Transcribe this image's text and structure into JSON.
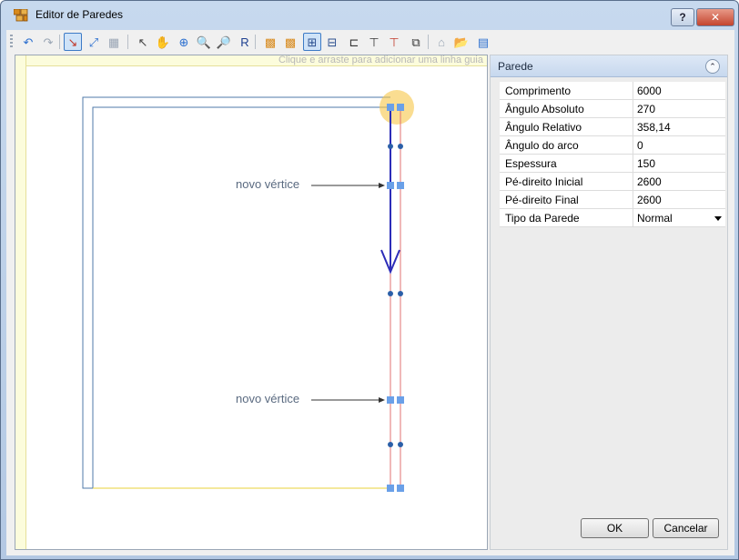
{
  "window": {
    "title": "Editor de Paredes",
    "help_label": "?",
    "close_label": "✕"
  },
  "toolbar": {
    "tools": [
      {
        "icon": "undo-icon",
        "glyph": "↶",
        "color": "#2b6fcf"
      },
      {
        "icon": "redo-icon",
        "glyph": "↷",
        "color": "#9aa6b5"
      },
      {
        "icon": "draw-wall-icon",
        "glyph": "↘",
        "color": "#c0392b"
      },
      {
        "icon": "split-wall-icon",
        "glyph": "⤢",
        "color": "#2b6fcf"
      },
      {
        "icon": "grid-icon",
        "glyph": "▦",
        "color": "#9aa6b5"
      },
      {
        "icon": "select-pointer-icon",
        "glyph": "↖",
        "color": "#444444"
      },
      {
        "icon": "pan-hand-icon",
        "glyph": "✋",
        "color": "#8a5a00"
      },
      {
        "icon": "zoom-extents-icon",
        "glyph": "⊕",
        "color": "#2b6fcf"
      },
      {
        "icon": "zoom-in-icon",
        "glyph": "🔍",
        "color": "#2b6fcf"
      },
      {
        "icon": "zoom-out-icon",
        "glyph": "🔎",
        "color": "#2b6fcf"
      },
      {
        "icon": "redraw-icon",
        "glyph": "R",
        "color": "#1d3f8f"
      },
      {
        "icon": "wall-block-icon",
        "glyph": "▩",
        "color": "#d88a1c"
      },
      {
        "icon": "wall-block-add-icon",
        "glyph": "▩",
        "color": "#d88a1c"
      },
      {
        "icon": "add-vertex-icon",
        "glyph": "⊞",
        "color": "#2b4f8f"
      },
      {
        "icon": "remove-vertex-icon",
        "glyph": "⊟",
        "color": "#2b4f8f"
      },
      {
        "icon": "align-icon",
        "glyph": "⊏",
        "color": "#333333"
      },
      {
        "icon": "measure-icon",
        "glyph": "⊤",
        "color": "#333333"
      },
      {
        "icon": "mark-icon",
        "glyph": "⊤",
        "color": "#c0392b"
      },
      {
        "icon": "copy-icon",
        "glyph": "⧉",
        "color": "#333333"
      },
      {
        "icon": "roof-icon",
        "glyph": "⌂",
        "color": "#9aa6b5"
      },
      {
        "icon": "import-icon",
        "glyph": "📂",
        "color": "#d88a1c"
      },
      {
        "icon": "export-icon",
        "glyph": "▤",
        "color": "#2b6fcf"
      }
    ]
  },
  "canvas": {
    "guide_hint": "Clique e arraste para adicionar uma linha guia",
    "annotations": [
      "novo vértice",
      "novo vértice"
    ]
  },
  "properties": {
    "header": "Parede",
    "rows": [
      {
        "name": "Comprimento",
        "value": "6000"
      },
      {
        "name": "Ângulo Absoluto",
        "value": "270"
      },
      {
        "name": "Ângulo Relativo",
        "value": "358,14"
      },
      {
        "name": "Ângulo do arco",
        "value": "0"
      },
      {
        "name": "Espessura",
        "value": "150"
      },
      {
        "name": "Pé-direito Inicial",
        "value": "2600"
      },
      {
        "name": "Pé-direito Final",
        "value": "2600"
      },
      {
        "name": "Tipo da Parede",
        "value": "Normal"
      }
    ]
  },
  "buttons": {
    "ok": "OK",
    "cancel": "Cancelar"
  },
  "colors": {
    "wall_outline": "#4f7aa8",
    "selected_wall": "#2c2cb8",
    "inner_wall_edge": "#e07070",
    "vertex": "#6aa0e8",
    "highlight": "#f7c748",
    "floor_edge": "#e8d23a"
  }
}
